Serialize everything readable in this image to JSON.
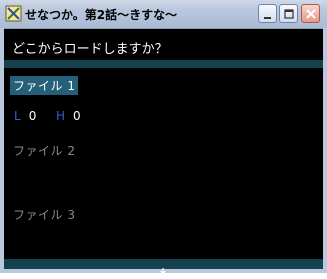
{
  "window": {
    "title": "せなつか。第2話〜きすな〜"
  },
  "dialog": {
    "prompt": "どこからロードしますか？"
  },
  "slots": [
    {
      "label": "ファイル 1"
    },
    {
      "label": "ファイル 2"
    },
    {
      "label": "ファイル 3"
    }
  ],
  "stats": {
    "l_label": "L",
    "l_value": "0",
    "h_label": "H",
    "h_value": "0"
  },
  "colors": {
    "highlight": "#25607a",
    "separator": "#15424e",
    "stat_key": "#2e62c8"
  }
}
